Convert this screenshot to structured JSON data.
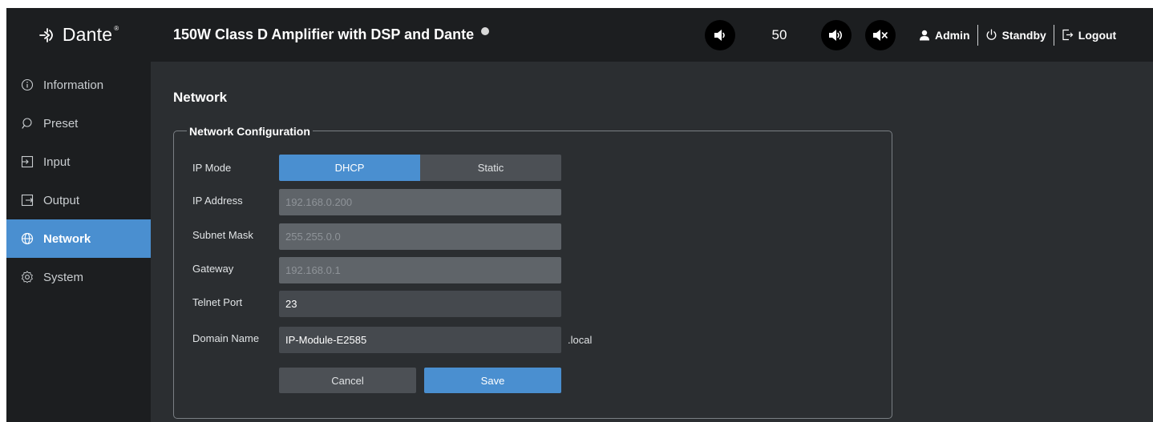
{
  "brand": {
    "logo_text": "Dante",
    "logo_tm": "®"
  },
  "header": {
    "title": "150W Class D Amplifier with DSP and Dante",
    "volume_value": "50",
    "user": "Admin",
    "standby": "Standby",
    "logout": "Logout",
    "icons": {
      "volume_down": "volume-down-icon",
      "volume_up": "volume-up-icon",
      "mute": "mute-icon",
      "user": "user-icon",
      "power": "power-icon",
      "logout": "logout-icon"
    }
  },
  "sidebar": {
    "items": [
      {
        "label": "Information",
        "icon": "info-icon"
      },
      {
        "label": "Preset",
        "icon": "preset-icon"
      },
      {
        "label": "Input",
        "icon": "input-icon"
      },
      {
        "label": "Output",
        "icon": "output-icon"
      },
      {
        "label": "Network",
        "icon": "globe-icon",
        "active": true
      },
      {
        "label": "System",
        "icon": "gear-icon"
      }
    ]
  },
  "main": {
    "page_title": "Network",
    "section_title": "Network Configuration",
    "fields": {
      "ip_mode": {
        "label": "IP Mode",
        "options": [
          "DHCP",
          "Static"
        ],
        "selected": "DHCP"
      },
      "ip_address": {
        "label": "IP Address",
        "value": "192.168.0.200"
      },
      "subnet_mask": {
        "label": "Subnet Mask",
        "value": "255.255.0.0"
      },
      "gateway": {
        "label": "Gateway",
        "value": "192.168.0.1"
      },
      "telnet_port": {
        "label": "Telnet Port",
        "value": "23"
      },
      "domain_name": {
        "label": "Domain Name",
        "value": "IP-Module-E2585",
        "suffix": ".local"
      }
    },
    "buttons": {
      "cancel": "Cancel",
      "save": "Save"
    }
  },
  "colors": {
    "accent": "#4a8fd0",
    "background": "#2b2e31",
    "panel": "#1c1e20"
  }
}
